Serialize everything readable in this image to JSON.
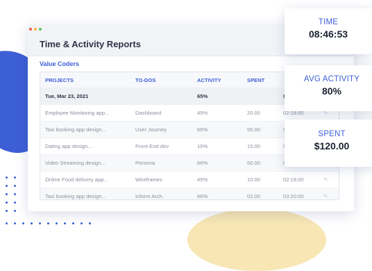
{
  "window": {
    "title": "Time & Activity Reports",
    "organization": "Value Coders"
  },
  "table": {
    "headers": [
      "PROJECTS",
      "TO-DOS",
      "ACTIVITY",
      "SPENT"
    ],
    "date_row": {
      "date": "Tue, Mar 23, 2021",
      "activity": "65%",
      "time": "02"
    },
    "rows": [
      {
        "project": "Employee Monitoring app...",
        "todo": "Dashboard",
        "activity": "45%",
        "spent": "20.00",
        "time": "02:18:00"
      },
      {
        "project": "Taxi booking app design...",
        "todo": "User Journey",
        "activity": "66%",
        "spent": "55.00",
        "time": "0"
      },
      {
        "project": "Dating app design...",
        "todo": "Front-End dev",
        "activity": "15%",
        "spent": "15.00",
        "time": "0"
      },
      {
        "project": "Video Streaming design...",
        "todo": "Persona",
        "activity": "66%",
        "spent": "50.00",
        "time": "0"
      },
      {
        "project": "Online Food delivery app...",
        "todo": "Wireframes",
        "activity": "45%",
        "spent": "10.00",
        "time": "02:18:00"
      },
      {
        "project": "Taxi booking app design...",
        "todo": "Inform Arch.",
        "activity": "66%",
        "spent": "02.00",
        "time": "03:20:00"
      }
    ]
  },
  "cards": {
    "time": {
      "label": "TIME",
      "value": "08:46:53"
    },
    "avg_activity": {
      "label": "AVG ACTIVITY",
      "value": "80%"
    },
    "spent": {
      "label": "SPENT",
      "value": "$120.00"
    }
  },
  "colors": {
    "accent": "#3d5fd6",
    "accent_yellow": "#f8e6b5"
  },
  "icons": {
    "row_action": "pencil-icon"
  }
}
